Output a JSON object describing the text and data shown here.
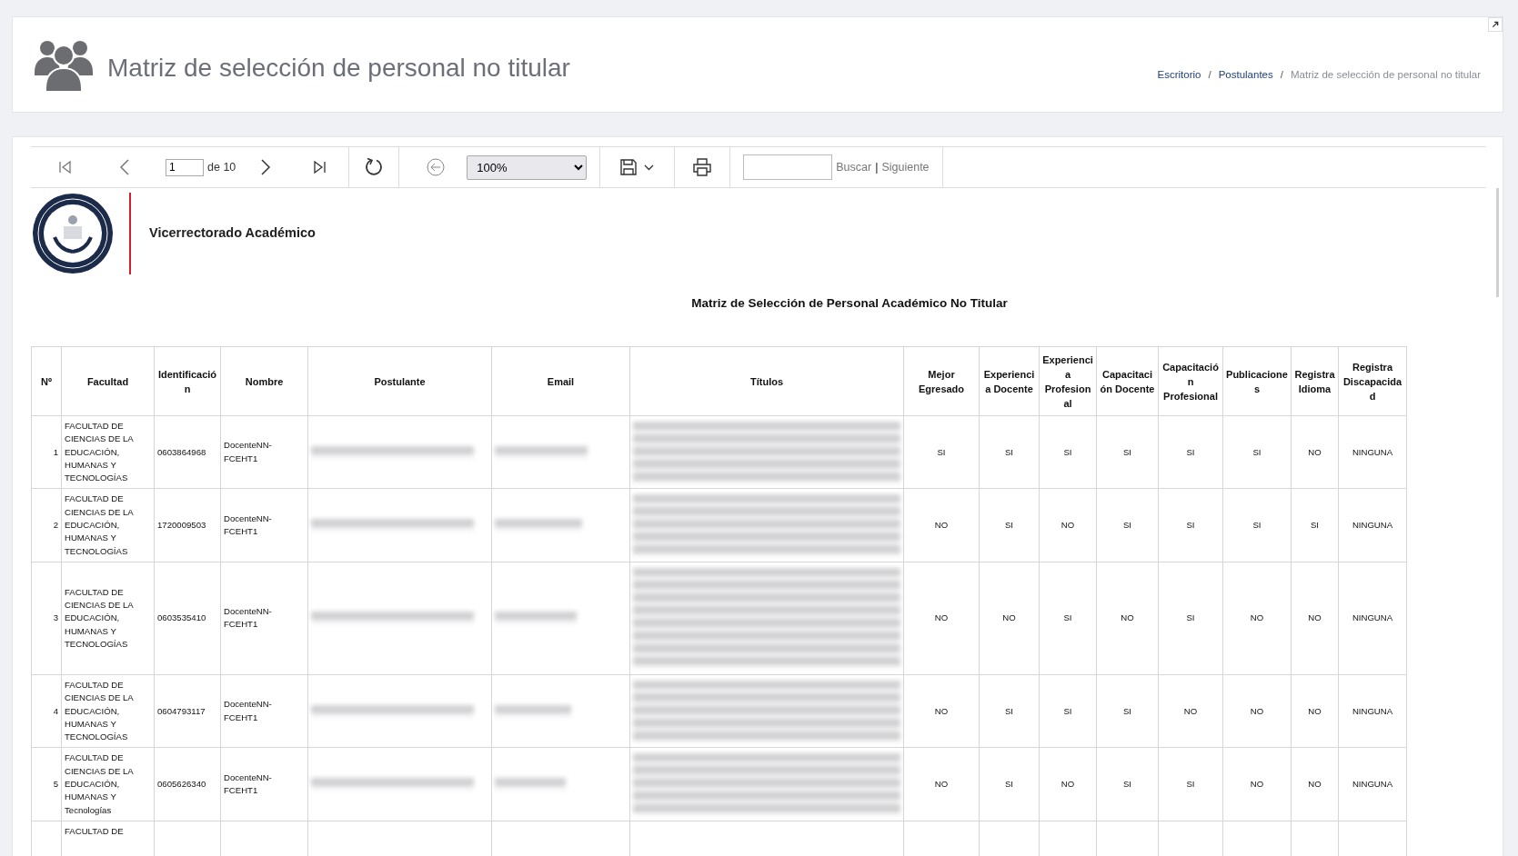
{
  "header": {
    "title": "Matriz de selección de personal no titular",
    "breadcrumb_separator": "/",
    "breadcrumb": [
      {
        "label": "Escritorio",
        "active": false
      },
      {
        "label": "Postulantes",
        "active": false
      },
      {
        "label": "Matriz de selección de personal no titular",
        "active": true
      }
    ]
  },
  "viewer_toolbar": {
    "page": "1",
    "page_total": "de 10",
    "zoom": "100%",
    "find_label": "Buscar",
    "find_separator": "|",
    "next_label": "Siguiente"
  },
  "report": {
    "unit": "Vicerrectorado Académico",
    "title": "Matriz de Selección de Personal Académico No Titular",
    "table": {
      "columns": [
        "Nº",
        "Facultad",
        "Identificación",
        "Nombre",
        "Postulante",
        "Email",
        "Títulos",
        "Mejor Egresado",
        "Experiencia Docente",
        "Experiencia Profesional",
        "Capacitación Docente",
        "Capacitación Profesional",
        "Publicaciones",
        "Registra Idioma",
        "Registra Discapacidad"
      ],
      "rows": [
        {
          "no": "1",
          "facultad": "FACULTAD DE CIENCIAS DE LA EDUCACIÓN, HUMANAS Y TECNOLOGÍAS",
          "identificacion": "0603864968",
          "nombre": "DocenteNN-FCEHT1",
          "redacted": true,
          "values": [
            "SI",
            "SI",
            "SI",
            "SI",
            "SI",
            "SI",
            "NO",
            "NINGUNA"
          ]
        },
        {
          "no": "2",
          "facultad": "FACULTAD DE CIENCIAS DE LA EDUCACIÓN, HUMANAS Y TECNOLOGÍAS",
          "identificacion": "1720009503",
          "nombre": "DocenteNN-FCEHT1",
          "redacted": true,
          "values": [
            "NO",
            "SI",
            "NO",
            "SI",
            "SI",
            "SI",
            "SI",
            "NINGUNA"
          ]
        },
        {
          "no": "3",
          "facultad": "FACULTAD DE CIENCIAS DE LA EDUCACIÓN, HUMANAS Y TECNOLOGÍAS",
          "identificacion": "0603535410",
          "nombre": "DocenteNN-FCEHT1",
          "redacted": true,
          "tall": true,
          "values": [
            "NO",
            "NO",
            "SI",
            "NO",
            "SI",
            "NO",
            "NO",
            "NINGUNA"
          ]
        },
        {
          "no": "4",
          "facultad": "FACULTAD DE CIENCIAS DE LA EDUCACIÓN, HUMANAS Y TECNOLOGÍAS",
          "identificacion": "0604793117",
          "nombre": "DocenteNN-FCEHT1",
          "redacted": true,
          "values": [
            "NO",
            "SI",
            "SI",
            "SI",
            "NO",
            "NO",
            "NO",
            "NINGUNA"
          ]
        },
        {
          "no": "5",
          "facultad": "FACULTAD DE CIENCIAS DE LA EDUCACIÓN, HUMANAS Y Tecnologías",
          "identificacion": "0605626340",
          "nombre": "DocenteNN-FCEHT1",
          "redacted": true,
          "values": [
            "NO",
            "SI",
            "NO",
            "SI",
            "SI",
            "NO",
            "NO",
            "NINGUNA"
          ]
        },
        {
          "facultad": "FACULTAD DE"
        }
      ]
    }
  }
}
